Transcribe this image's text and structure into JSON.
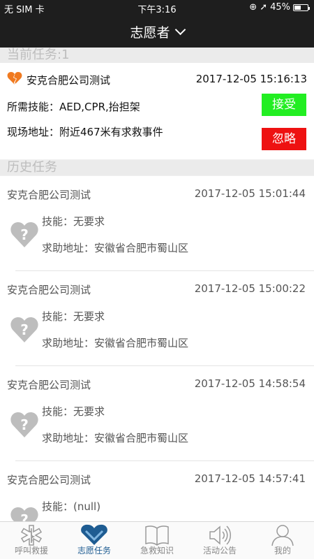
{
  "status_bar": {
    "carrier": "无 SIM 卡",
    "time": "下午3:16",
    "battery": "45%",
    "battery_level": 0.45
  },
  "navbar": {
    "title": "志愿者"
  },
  "current": {
    "section_title": "当前任务:1",
    "task_name": "安克合肥公司测试",
    "time": "2017-12-05 15:16:13",
    "skills": "所需技能：AED,CPR,抬担架",
    "location": "现场地址：附近467米有求救事件",
    "accept_label": "接受",
    "ignore_label": "忽略"
  },
  "history": {
    "section_title": "历史任务",
    "items": [
      {
        "name": "安克合肥公司测试",
        "time": "2017-12-05 15:01:44",
        "skill": "技能：无要求",
        "address": "求助地址：安徽省合肥市蜀山区"
      },
      {
        "name": "安克合肥公司测试",
        "time": "2017-12-05 15:00:22",
        "skill": "技能：无要求",
        "address": "求助地址：安徽省合肥市蜀山区"
      },
      {
        "name": "安克合肥公司测试",
        "time": "2017-12-05 14:58:54",
        "skill": "技能：无要求",
        "address": "求助地址：安徽省合肥市蜀山区"
      },
      {
        "name": "安克合肥公司测试",
        "time": "2017-12-05 14:57:41",
        "skill": "技能：(null)",
        "address": ""
      }
    ]
  },
  "tabbar": {
    "items": [
      {
        "label": "呼叫救援"
      },
      {
        "label": "志愿任务"
      },
      {
        "label": "急救知识"
      },
      {
        "label": "活动公告"
      },
      {
        "label": "我的"
      }
    ]
  },
  "colors": {
    "accent": "#1e5c92",
    "accept": "#22ee22",
    "ignore": "#ee1111",
    "bar": "#1e1e1e"
  }
}
